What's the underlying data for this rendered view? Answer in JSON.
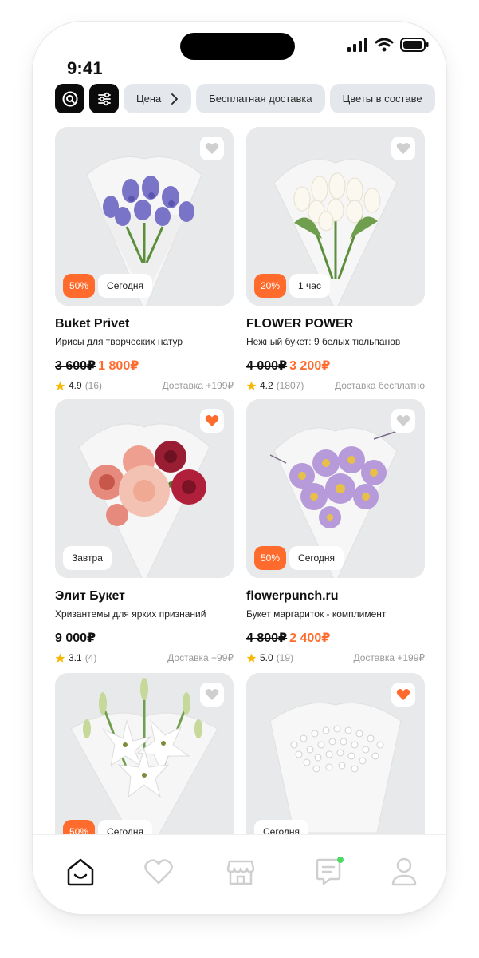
{
  "status": {
    "time": "9:41"
  },
  "filters": {
    "search_icon": "search-icon",
    "settings_icon": "sliders-icon",
    "chips": [
      "Цена",
      "Бесплатная доставка",
      "Цветы в составе"
    ]
  },
  "colors": {
    "accent": "#ff6b2c",
    "chip_bg": "#e4e7eb",
    "rating_star": "#f6b800",
    "notify_dot": "#4cd964"
  },
  "products": [
    {
      "title": "Buket Privet",
      "desc": "Ирисы для творческих натур",
      "old_price": "3 600₽",
      "price": "1 800₽",
      "rating": "4.9",
      "reviews": "(16)",
      "delivery": "Доставка +199₽",
      "discount": "50%",
      "when": "Сегодня",
      "favorite": false,
      "flowers": "iris"
    },
    {
      "title": "FLOWER POWER",
      "desc": "Нежный букет: 9 белых тюльпанов",
      "old_price": "4 000₽",
      "price": "3 200₽",
      "rating": "4.2",
      "reviews": "(1807)",
      "delivery": "Доставка бесплатно",
      "discount": "20%",
      "when": "1 час",
      "favorite": false,
      "flowers": "tulip"
    },
    {
      "title": "Элит Букет",
      "desc": "Хризантемы для ярких признаний",
      "old_price": "",
      "price": "9 000₽",
      "rating": "3.1",
      "reviews": "(4)",
      "delivery": "Доставка +99₽",
      "discount": "",
      "when": "Завтра",
      "favorite": true,
      "flowers": "dahlia"
    },
    {
      "title": "flowerpunch.ru",
      "desc": "Букет маргариток - комплимент",
      "old_price": "4 800₽",
      "price": "2 400₽",
      "rating": "5.0",
      "reviews": "(19)",
      "delivery": "Доставка +199₽",
      "discount": "50%",
      "when": "Сегодня",
      "favorite": false,
      "flowers": "daisy"
    },
    {
      "title": "",
      "desc": "",
      "old_price": "",
      "price": "",
      "rating": "",
      "reviews": "",
      "delivery": "",
      "discount": "50%",
      "when": "Сегодня",
      "favorite": false,
      "flowers": "lily"
    },
    {
      "title": "",
      "desc": "",
      "old_price": "",
      "price": "",
      "rating": "",
      "reviews": "",
      "delivery": "",
      "discount": "",
      "when": "Сегодня",
      "favorite": true,
      "flowers": "gypsophila"
    }
  ],
  "tabbar": {
    "items": [
      {
        "icon": "home-icon",
        "active": true
      },
      {
        "icon": "heart-icon",
        "active": false
      },
      {
        "icon": "shop-icon",
        "active": false
      },
      {
        "icon": "chat-icon",
        "active": false,
        "badge": true
      },
      {
        "icon": "profile-icon",
        "active": false
      }
    ]
  }
}
